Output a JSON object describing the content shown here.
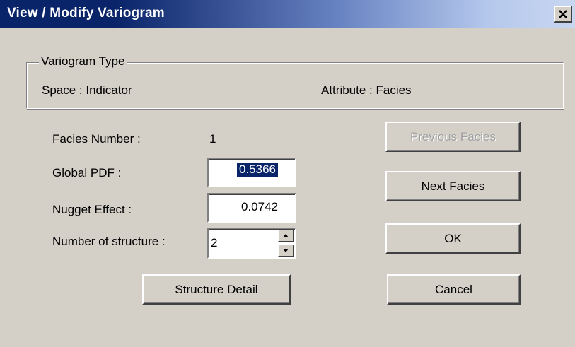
{
  "window": {
    "title": "View / Modify Variogram",
    "close_icon": "close-icon"
  },
  "variogram_type": {
    "legend": "Variogram Type",
    "space": "Space : Indicator",
    "attribute": "Attribute : Facies"
  },
  "form": {
    "facies_number_label": "Facies Number :",
    "facies_number_value": "1",
    "global_pdf_label": "Global PDF :",
    "global_pdf_value": "0.5366",
    "nugget_effect_label": "Nugget Effect :",
    "nugget_effect_value": "0.0742",
    "num_structure_label": "Number of structure :",
    "num_structure_value": "2"
  },
  "buttons": {
    "previous_facies": "Previous Facies",
    "next_facies": "Next Facies",
    "ok": "OK",
    "cancel": "Cancel",
    "structure_detail": "Structure Detail"
  },
  "colors": {
    "title_bar": "#0a246a",
    "dialog_face": "#d4d0c8",
    "selection": "#0a246a"
  }
}
